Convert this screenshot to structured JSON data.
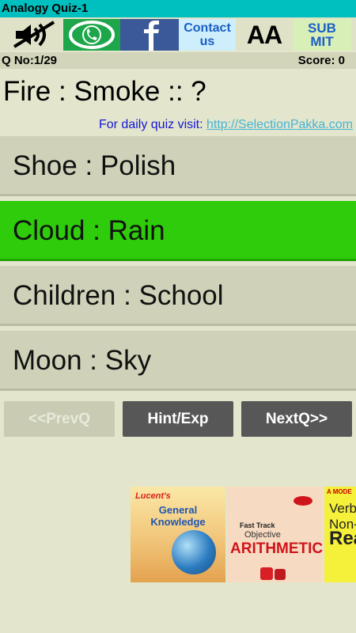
{
  "app": {
    "title": "Analogy Quiz-1"
  },
  "toolbar": {
    "mute_icon": "speaker-muted-icon",
    "whatsapp_icon": "whatsapp-icon",
    "facebook_icon": "facebook-icon",
    "contact_line1": "Contact",
    "contact_line2": "us",
    "font_size_label": "AA",
    "submit_line1": "SUB",
    "submit_line2": "MIT"
  },
  "status": {
    "question_number": "Q No:1/29",
    "score": "Score: 0"
  },
  "question": {
    "text": "Fire : Smoke :: ?",
    "daily_prefix": "For daily quiz visit: ",
    "daily_link": "http://SelectionPakka.com"
  },
  "options": [
    {
      "label": "Shoe : Polish",
      "state": "normal"
    },
    {
      "label": "Cloud : Rain",
      "state": "correct"
    },
    {
      "label": "Children : School",
      "state": "normal"
    },
    {
      "label": "Moon : Sky",
      "state": "normal"
    }
  ],
  "navigation": {
    "prev": "<<PrevQ",
    "hint": "Hint/Exp",
    "next": "NextQ>>"
  },
  "ads": {
    "book1_publisher": "Lucent's",
    "book1_line1": "General",
    "book1_line2": "Knowledge",
    "book2_line1": "Fast Track",
    "book2_line2": "Objective",
    "book2_line3": "ARITHMETIC",
    "book3_line1": "A MODE",
    "book3_line2a": "Verb",
    "book3_line2b": "Non-",
    "book3_line3": "Rea"
  },
  "colors": {
    "titlebar": "#00bfbf",
    "correct_option": "#2ecc0a",
    "link": "#47b3d6",
    "nav_button": "#575757"
  }
}
